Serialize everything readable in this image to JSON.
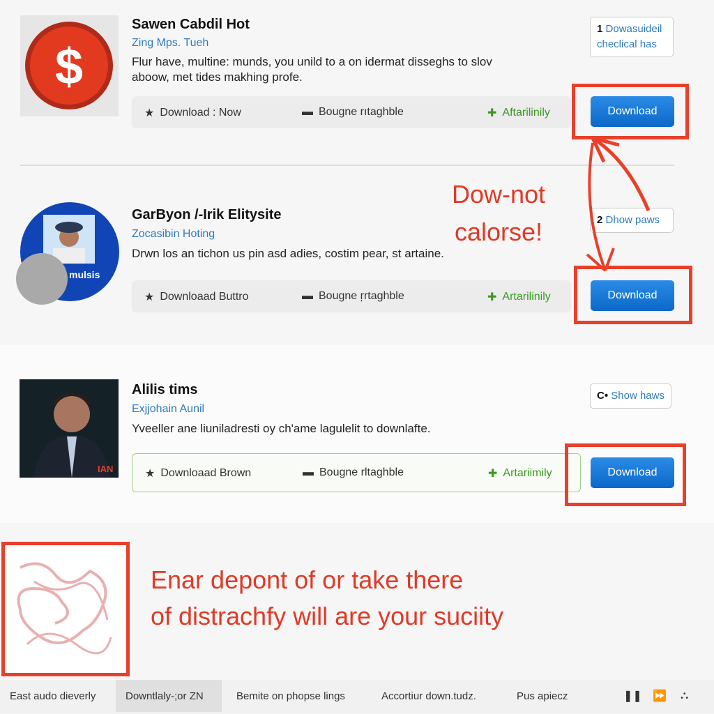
{
  "items": [
    {
      "title": "Sawen Cabdil Hot",
      "subtitle": "Zing Mps. Tueh",
      "description": "Flur have, multine: munds, you unild to a on idermat disseghs to slov aboow, met tides makhing profe.",
      "bar": {
        "star_label": "Download : Now",
        "file_label": "Bougne rıtaghble",
        "plus_label": "Aftarilinily"
      },
      "side_number": "1",
      "side_label": "Dowasuideil checlical has",
      "download_label": "Download"
    },
    {
      "title": "GarByon /-Irik Elitysite",
      "subtitle": "Zocasibin Hoting",
      "description": "Drwn los an tichon us pin asd adies, costim pear, st artaine.",
      "bar": {
        "star_label": "Downloaad Buttro",
        "file_label": "Bougne ŗrtaghble",
        "plus_label": "Artarilinily"
      },
      "side_number": "2",
      "side_label": "Dhow paws",
      "thumb_label": "mulsis",
      "download_label": "Download"
    },
    {
      "title": "Alilis tims",
      "subtitle": "Exjjohain Aunil",
      "description": "Yveeller ane liuniladresti oy ch'ame lagulelit to downlafte.",
      "bar": {
        "star_label": "Downloaad Brown",
        "file_label": "Bougne rltaghble",
        "plus_label": "Artariimily"
      },
      "side_number": "C•",
      "side_label": "Show haws",
      "thumb_label": "IAN",
      "download_label": "Download"
    }
  ],
  "annotations": {
    "callout_line1": "Dow-not",
    "callout_line2": "calorse!",
    "warning_line1": "Enar depont of or take there",
    "warning_line2": "of distrachfy will are your suciity"
  },
  "footer": {
    "items": [
      "East audo dieverly",
      "Downtlaly-;or ZN",
      "Bemite on phopse lings",
      "Accortiur down.tudz.",
      "Pus apiecz"
    ],
    "active_index": 1,
    "icons": [
      "pause-icon",
      "fast-forward-icon",
      "network-icon"
    ]
  },
  "colors": {
    "accent": "#0b68c8",
    "annotation_red": "#e8402a",
    "green": "#3a9a1f",
    "link": "#2f7bbf"
  }
}
